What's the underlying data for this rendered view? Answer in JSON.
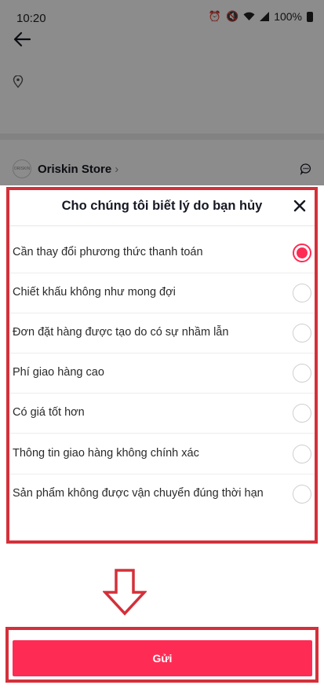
{
  "status_bar": {
    "time": "10:20",
    "battery": "100%",
    "icons": [
      "alarm-icon",
      "mute-icon",
      "wifi-icon",
      "signal-icon",
      "battery-icon"
    ]
  },
  "store": {
    "logo_text": "ORISKIN",
    "name": "Oriskin Store"
  },
  "dialog": {
    "title": "Cho chúng tôi biết lý do bạn hủy",
    "options": [
      {
        "label": "Cần thay đổi phương thức thanh toán",
        "selected": true
      },
      {
        "label": "Chiết khấu không như mong đợi",
        "selected": false
      },
      {
        "label": "Đơn đặt hàng được tạo do có sự nhầm lẫn",
        "selected": false
      },
      {
        "label": "Phí giao hàng cao",
        "selected": false
      },
      {
        "label": "Có giá tốt hơn",
        "selected": false
      },
      {
        "label": "Thông tin giao hàng không chính xác",
        "selected": false
      },
      {
        "label": "Sản phẩm không được vận chuyển đúng thời hạn",
        "selected": false
      }
    ],
    "submit_label": "Gửi"
  },
  "colors": {
    "accent": "#fe2c55",
    "annotation": "#d4303a"
  }
}
